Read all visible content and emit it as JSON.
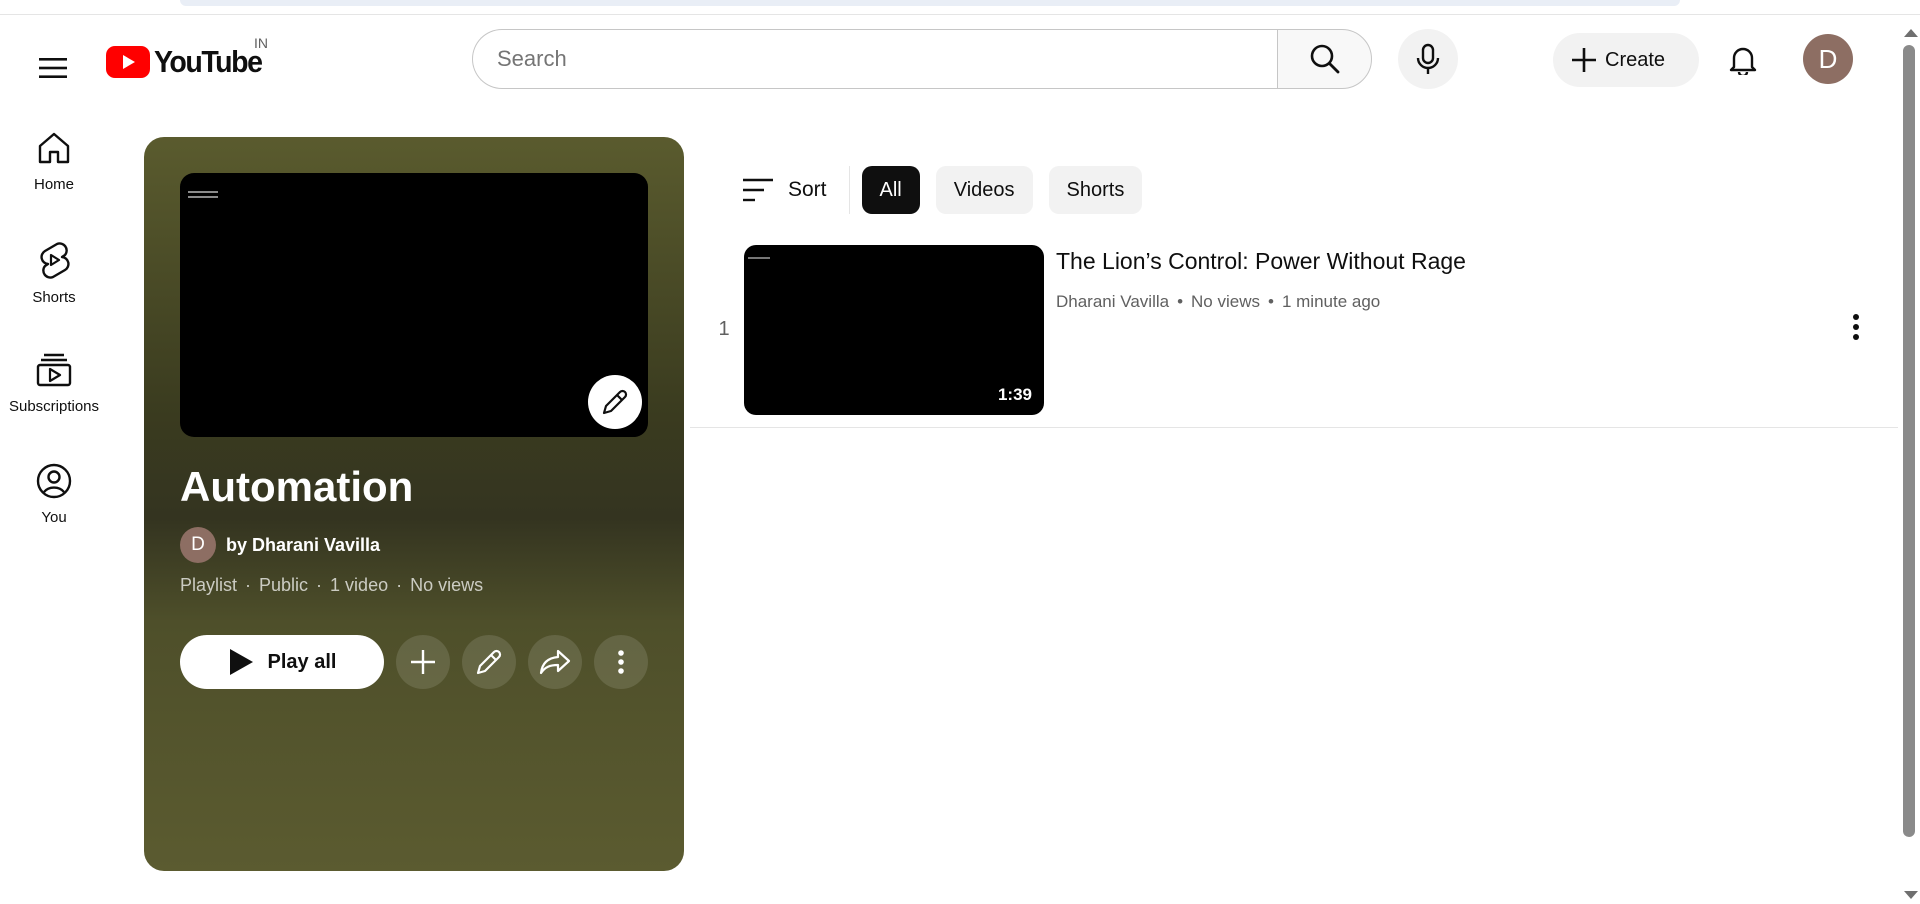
{
  "header": {
    "logo_text": "YouTube",
    "country_code": "IN",
    "search_placeholder": "Search",
    "create_label": "Create",
    "avatar_letter": "D"
  },
  "sidebar": {
    "items": [
      {
        "label": "Home",
        "icon": "home-icon"
      },
      {
        "label": "Shorts",
        "icon": "shorts-icon"
      },
      {
        "label": "Subscriptions",
        "icon": "subscriptions-icon"
      },
      {
        "label": "You",
        "icon": "you-icon"
      }
    ]
  },
  "playlist": {
    "title": "Automation",
    "owner_initial": "D",
    "owner": "by Dharani Vavilla",
    "meta": [
      "Playlist",
      "Public",
      "1 video",
      "No views"
    ],
    "play_all_label": "Play all"
  },
  "filters": {
    "sort_label": "Sort",
    "chips": [
      "All",
      "Videos",
      "Shorts"
    ],
    "active": "All"
  },
  "videos": [
    {
      "index": "1",
      "title": "The Lion’s Control: Power Without Rage",
      "channel": "Dharani Vavilla",
      "views": "No views",
      "age": "1 minute ago",
      "duration": "1:39"
    }
  ],
  "colors": {
    "brand_red": "#ff0000",
    "panel_olive": "#5a5b2e",
    "avatar_brown": "#8d6e63"
  }
}
